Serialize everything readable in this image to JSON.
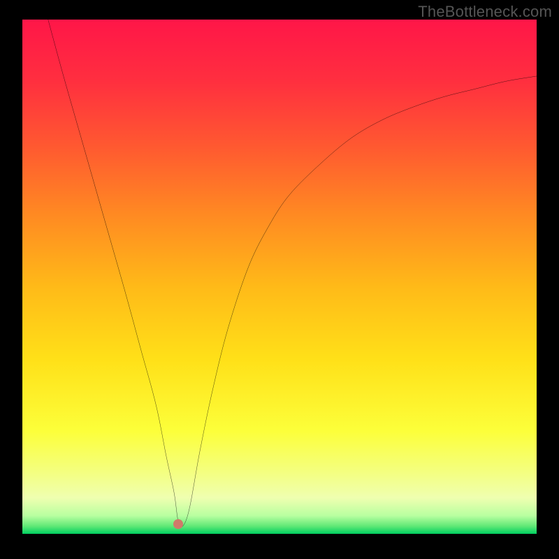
{
  "watermark": "TheBottleneck.com",
  "chart_data": {
    "type": "line",
    "title": "",
    "xlabel": "",
    "ylabel": "",
    "xlim": [
      0,
      100
    ],
    "ylim": [
      0,
      100
    ],
    "grid": false,
    "legend": false,
    "series": [
      {
        "name": "bottleneck-curve",
        "x": [
          5,
          8,
          12,
          16,
          20,
          23,
          26,
          28,
          29.5,
          30.3,
          31.2,
          32.5,
          34.5,
          37,
          40,
          44,
          48,
          52,
          58,
          64,
          70,
          76,
          82,
          88,
          94,
          100
        ],
        "y": [
          100,
          89,
          75,
          61,
          47,
          36,
          25,
          15,
          8,
          2.5,
          1.5,
          5,
          16,
          28,
          40,
          52,
          60,
          66,
          72,
          77,
          80.5,
          83,
          85,
          86.5,
          88,
          89
        ]
      }
    ],
    "marker": {
      "x": 30.3,
      "y": 2.5,
      "color": "#d07a6a"
    },
    "gradient_stops": [
      {
        "offset": 0.0,
        "color": "#ff1648"
      },
      {
        "offset": 0.12,
        "color": "#ff2f3f"
      },
      {
        "offset": 0.25,
        "color": "#ff5a30"
      },
      {
        "offset": 0.38,
        "color": "#ff8a22"
      },
      {
        "offset": 0.52,
        "color": "#ffba18"
      },
      {
        "offset": 0.66,
        "color": "#ffe018"
      },
      {
        "offset": 0.8,
        "color": "#fcff3a"
      },
      {
        "offset": 0.88,
        "color": "#f4ff80"
      },
      {
        "offset": 0.93,
        "color": "#efffb0"
      },
      {
        "offset": 0.965,
        "color": "#b8ffa0"
      },
      {
        "offset": 0.985,
        "color": "#60e876"
      },
      {
        "offset": 1.0,
        "color": "#00d060"
      }
    ]
  }
}
